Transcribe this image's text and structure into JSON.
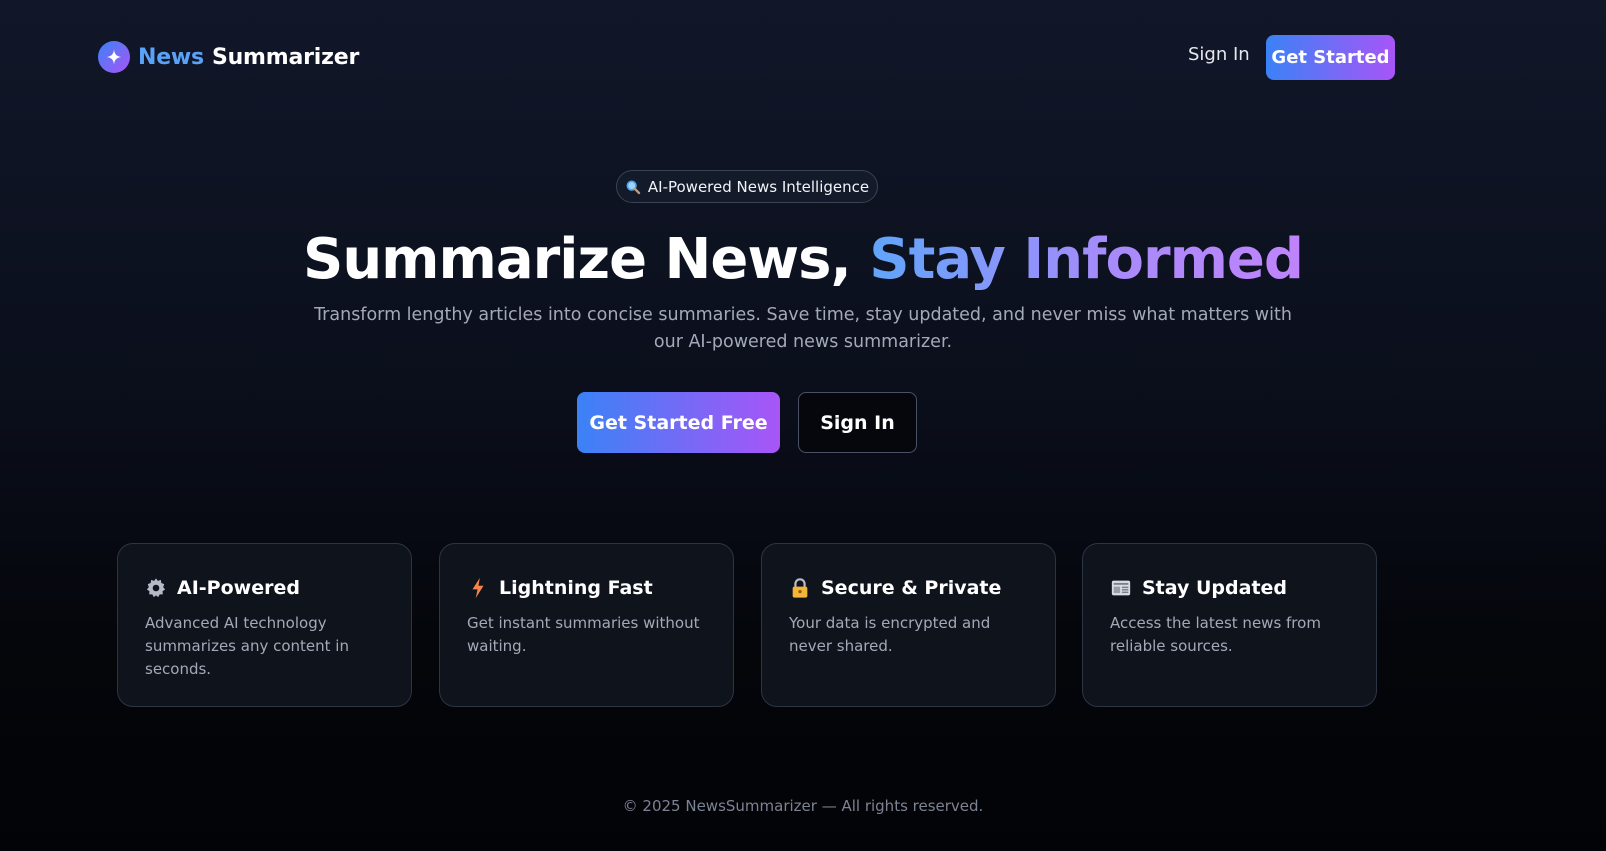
{
  "header": {
    "logo_icon": "sparkle-icon",
    "brand_first": "News",
    "brand_second": "Summarizer",
    "sign_in_label": "Sign In",
    "get_started_label": "Get Started"
  },
  "hero": {
    "badge_icon": "magnifier-icon",
    "badge_text": "AI-Powered News Intelligence",
    "title_plain": "Summarize News,",
    "title_highlight": "Stay Informed",
    "subtitle": "Transform lengthy articles into concise summaries. Save time, stay updated, and never miss what matters with our AI-powered news summarizer.",
    "primary_button": "Get Started Free",
    "secondary_button": "Sign In"
  },
  "features": [
    {
      "icon": "gear-icon",
      "title": "AI-Powered",
      "description": "Advanced AI technology summarizes any content in seconds."
    },
    {
      "icon": "lightning-icon",
      "title": "Lightning Fast",
      "description": "Get instant summaries without waiting."
    },
    {
      "icon": "lock-icon",
      "title": "Secure & Private",
      "description": "Your data is encrypted and never shared."
    },
    {
      "icon": "newspaper-icon",
      "title": "Stay Updated",
      "description": "Access the latest news from reliable sources."
    }
  ],
  "footer": {
    "copyright": "© 2025 NewsSummarizer — All rights reserved."
  },
  "colors": {
    "accent_start": "#3b82f6",
    "accent_end": "#a855f7",
    "background_top": "#111729",
    "background_bottom": "#020306",
    "card_background": "#0f131c",
    "muted_text": "#a3a9b8"
  }
}
